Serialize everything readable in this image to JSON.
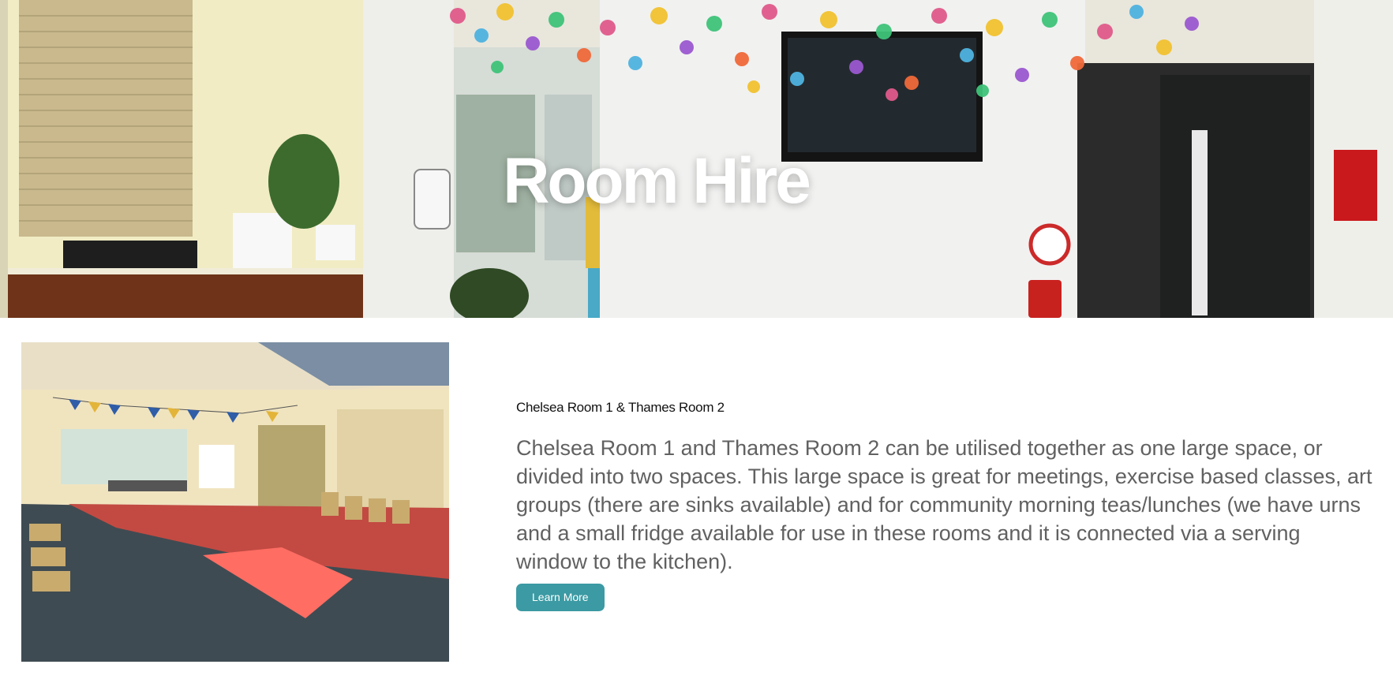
{
  "hero": {
    "title": "Room Hire",
    "image": "community-centre-reception-photo"
  },
  "room": {
    "image": "chelsea-thames-room-photo",
    "heading": "Chelsea Room 1 & Thames Room 2",
    "description": "Chelsea Room 1 and Thames Room 2 can be utilised together as one large space, or divided into two spaces. This large space is great for meetings, exercise based classes, art groups (there are sinks available) and for community morning teas/lunches (we have urns and a small fridge available for use in these rooms and it is connected via a serving window to the kitchen).",
    "button_label": "Learn More"
  },
  "colors": {
    "button": "#3b9aa3",
    "description_text": "#616161",
    "heading_text": "#111111"
  }
}
